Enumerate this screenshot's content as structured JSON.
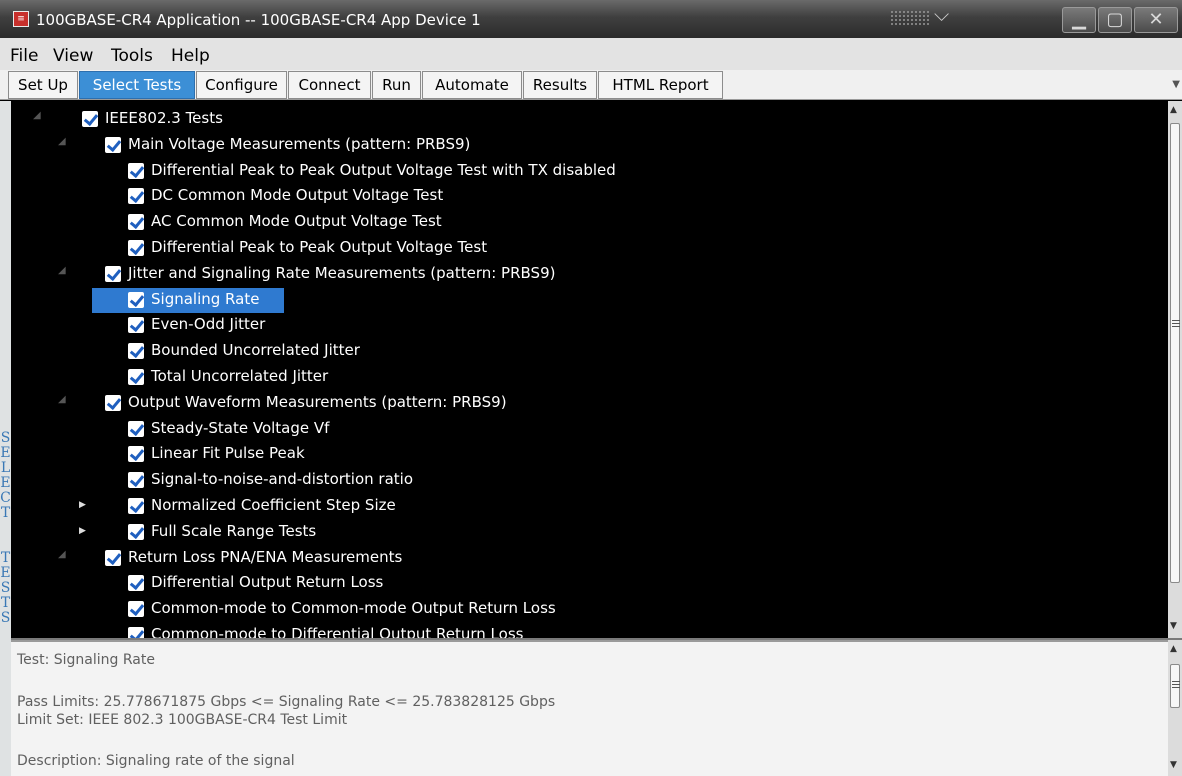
{
  "window": {
    "title": "100GBASE-CR4 Application -- 100GBASE-CR4 App Device 1",
    "app_icon": "app-logo-icon",
    "controls": [
      "minimize-icon",
      "maximize-icon",
      "close-icon"
    ]
  },
  "menu": [
    "File",
    "View",
    "Tools",
    "Help"
  ],
  "tabs": [
    {
      "label": "Set Up",
      "active": false
    },
    {
      "label": "Select Tests",
      "active": true
    },
    {
      "label": "Configure",
      "active": false
    },
    {
      "label": "Connect",
      "active": false
    },
    {
      "label": "Run",
      "active": false
    },
    {
      "label": "Automate",
      "active": false
    },
    {
      "label": "Results",
      "active": false
    },
    {
      "label": "HTML Report",
      "active": false
    }
  ],
  "sidebar_label": "SELECT TESTS",
  "tree": [
    {
      "label": "IEEE802.3 Tests",
      "level": 0,
      "expand": "expanded",
      "checked": true
    },
    {
      "label": "Main Voltage Measurements (pattern: PRBS9)",
      "level": 1,
      "expand": "expanded",
      "checked": true
    },
    {
      "label": "Differential Peak to Peak Output Voltage Test with TX disabled",
      "level": 2,
      "expand": "none",
      "checked": true
    },
    {
      "label": "DC Common Mode Output Voltage Test",
      "level": 2,
      "expand": "none",
      "checked": true
    },
    {
      "label": "AC Common Mode Output Voltage Test",
      "level": 2,
      "expand": "none",
      "checked": true
    },
    {
      "label": "Differential Peak to Peak Output Voltage Test",
      "level": 2,
      "expand": "none",
      "checked": true
    },
    {
      "label": "Jitter and Signaling Rate Measurements (pattern: PRBS9)",
      "level": 1,
      "expand": "expanded",
      "checked": true
    },
    {
      "label": "Signaling Rate",
      "level": 2,
      "expand": "none",
      "checked": true,
      "selected": true
    },
    {
      "label": "Even-Odd Jitter",
      "level": 2,
      "expand": "none",
      "checked": true
    },
    {
      "label": "Bounded Uncorrelated Jitter",
      "level": 2,
      "expand": "none",
      "checked": true
    },
    {
      "label": "Total Uncorrelated Jitter",
      "level": 2,
      "expand": "none",
      "checked": true
    },
    {
      "label": "Output Waveform Measurements (pattern: PRBS9)",
      "level": 1,
      "expand": "expanded",
      "checked": true
    },
    {
      "label": "Steady-State Voltage Vf",
      "level": 2,
      "expand": "none",
      "checked": true
    },
    {
      "label": "Linear Fit Pulse Peak",
      "level": 2,
      "expand": "none",
      "checked": true
    },
    {
      "label": "Signal-to-noise-and-distortion ratio",
      "level": 2,
      "expand": "none",
      "checked": true
    },
    {
      "label": "Normalized Coefficient Step Size",
      "level": 2,
      "expand": "collapsed",
      "checked": true
    },
    {
      "label": "Full Scale Range Tests",
      "level": 2,
      "expand": "collapsed",
      "checked": true
    },
    {
      "label": "Return Loss PNA/ENA Measurements",
      "level": 1,
      "expand": "expanded",
      "checked": true
    },
    {
      "label": "Differential Output Return Loss",
      "level": 2,
      "expand": "none",
      "checked": true
    },
    {
      "label": "Common-mode to Common-mode Output Return Loss",
      "level": 2,
      "expand": "none",
      "checked": true
    },
    {
      "label": "Common-mode to Differential Output Return Loss",
      "level": 2,
      "expand": "none",
      "checked": true
    }
  ],
  "details": {
    "test": "Test: Signaling Rate",
    "pass_limits": "Pass Limits: 25.778671875 Gbps <= Signaling Rate <= 25.783828125 Gbps",
    "limit_set": "Limit Set: IEEE 802.3 100GBASE-CR4 Test Limit",
    "description": "Description: Signaling rate of the signal"
  },
  "colors": {
    "selection": "#2f7ad0",
    "active_tab": "#3c8fd6",
    "checkmark": "#1f5fbf"
  }
}
